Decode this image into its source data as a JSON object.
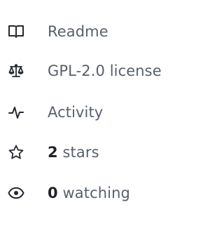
{
  "about_links": {
    "readme": {
      "icon": "book-icon",
      "label": "Readme"
    },
    "license": {
      "icon": "law-scale-icon",
      "label": "GPL-2.0 license"
    },
    "activity": {
      "icon": "pulse-icon",
      "label": "Activity"
    },
    "stars": {
      "icon": "star-icon",
      "count": "2",
      "suffix": "stars"
    },
    "watching": {
      "icon": "eye-icon",
      "count": "0",
      "suffix": "watching"
    }
  },
  "colors": {
    "text": "#57606a",
    "count": "#1f2328",
    "icon": "#24292f"
  }
}
